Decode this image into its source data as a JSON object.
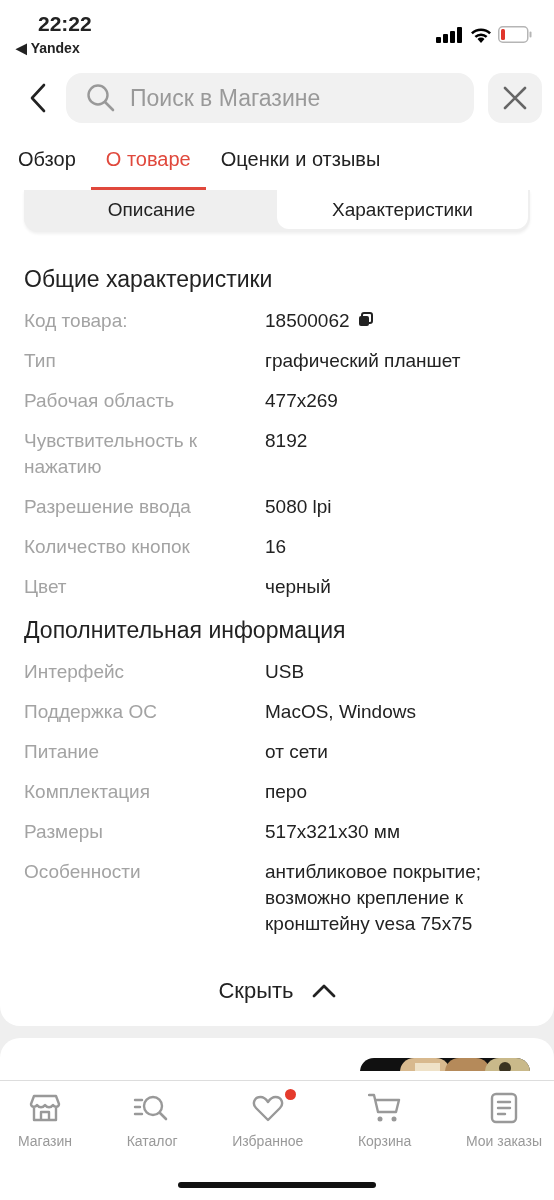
{
  "status_bar": {
    "time": "22:22",
    "back_app": "◀ Yandex"
  },
  "search": {
    "placeholder": "Поиск в Магазине"
  },
  "tabs": [
    {
      "label": "Обзор",
      "selected": false
    },
    {
      "label": "О товаре",
      "selected": true
    },
    {
      "label": "Оценки и отзывы",
      "selected": false
    }
  ],
  "segments": [
    {
      "label": "Описание",
      "selected": false
    },
    {
      "label": "Характеристики",
      "selected": true
    }
  ],
  "sections": [
    {
      "title": "Общие характеристики",
      "rows": [
        {
          "label": "Код товара:",
          "value": "18500062",
          "copyable": true
        },
        {
          "label": "Тип",
          "value": "графический планшет",
          "copyable": false
        },
        {
          "label": "Рабочая область",
          "value": "477x269",
          "copyable": false
        },
        {
          "label": "Чувствительность к нажатию",
          "value": "8192",
          "copyable": false
        },
        {
          "label": "Разрешение ввода",
          "value": "5080 lpi",
          "copyable": false
        },
        {
          "label": "Количество кнопок",
          "value": "16",
          "copyable": false
        },
        {
          "label": "Цвет",
          "value": "черный",
          "copyable": false
        }
      ]
    },
    {
      "title": "Дополнительная информация",
      "rows": [
        {
          "label": "Интерфейс",
          "value": "USB",
          "copyable": false
        },
        {
          "label": "Поддержка ОС",
          "value": "MacOS, Windows",
          "copyable": false
        },
        {
          "label": "Питание",
          "value": "от сети",
          "copyable": false
        },
        {
          "label": "Комплектация",
          "value": "перо",
          "copyable": false
        },
        {
          "label": "Размеры",
          "value": "517x321x30 мм",
          "copyable": false
        },
        {
          "label": "Особенности",
          "value": "антибликовое покрытие; возможно крепление к кронштейну vesa 75x75",
          "copyable": false
        }
      ]
    }
  ],
  "hide_button": "Скрыть",
  "nav": [
    {
      "kind": "shop",
      "label": "Магазин",
      "badge": false
    },
    {
      "kind": "catalog",
      "label": "Каталог",
      "badge": false
    },
    {
      "kind": "favorites",
      "label": "Избранное",
      "badge": true
    },
    {
      "kind": "cart",
      "label": "Корзина",
      "badge": false
    },
    {
      "kind": "orders",
      "label": "Мои заказы",
      "badge": false
    }
  ]
}
